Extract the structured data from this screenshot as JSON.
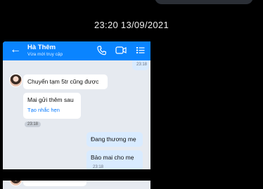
{
  "timestamp": "23:20 13/09/2021",
  "header": {
    "back_icon": "←",
    "contact_name": "Hà Thêm",
    "status": "Vừa mới truy cập"
  },
  "messages": {
    "partial_time": "23:18",
    "m1": "Chuyển tạm 5tr cũng được",
    "m2": "Mai gửi thêm sau",
    "m2_action": "Tạo nhắc hẹn",
    "m2_time": "23:18",
    "m3": "Đang thương mẹ",
    "m4": "Bảo mai cho mẹ",
    "m4_time": "23:18"
  },
  "colors": {
    "accent": "#0a84ff",
    "my_bubble": "#d9ebff",
    "their_bubble": "#ffffff",
    "chat_bg": "#e6eaf0"
  }
}
